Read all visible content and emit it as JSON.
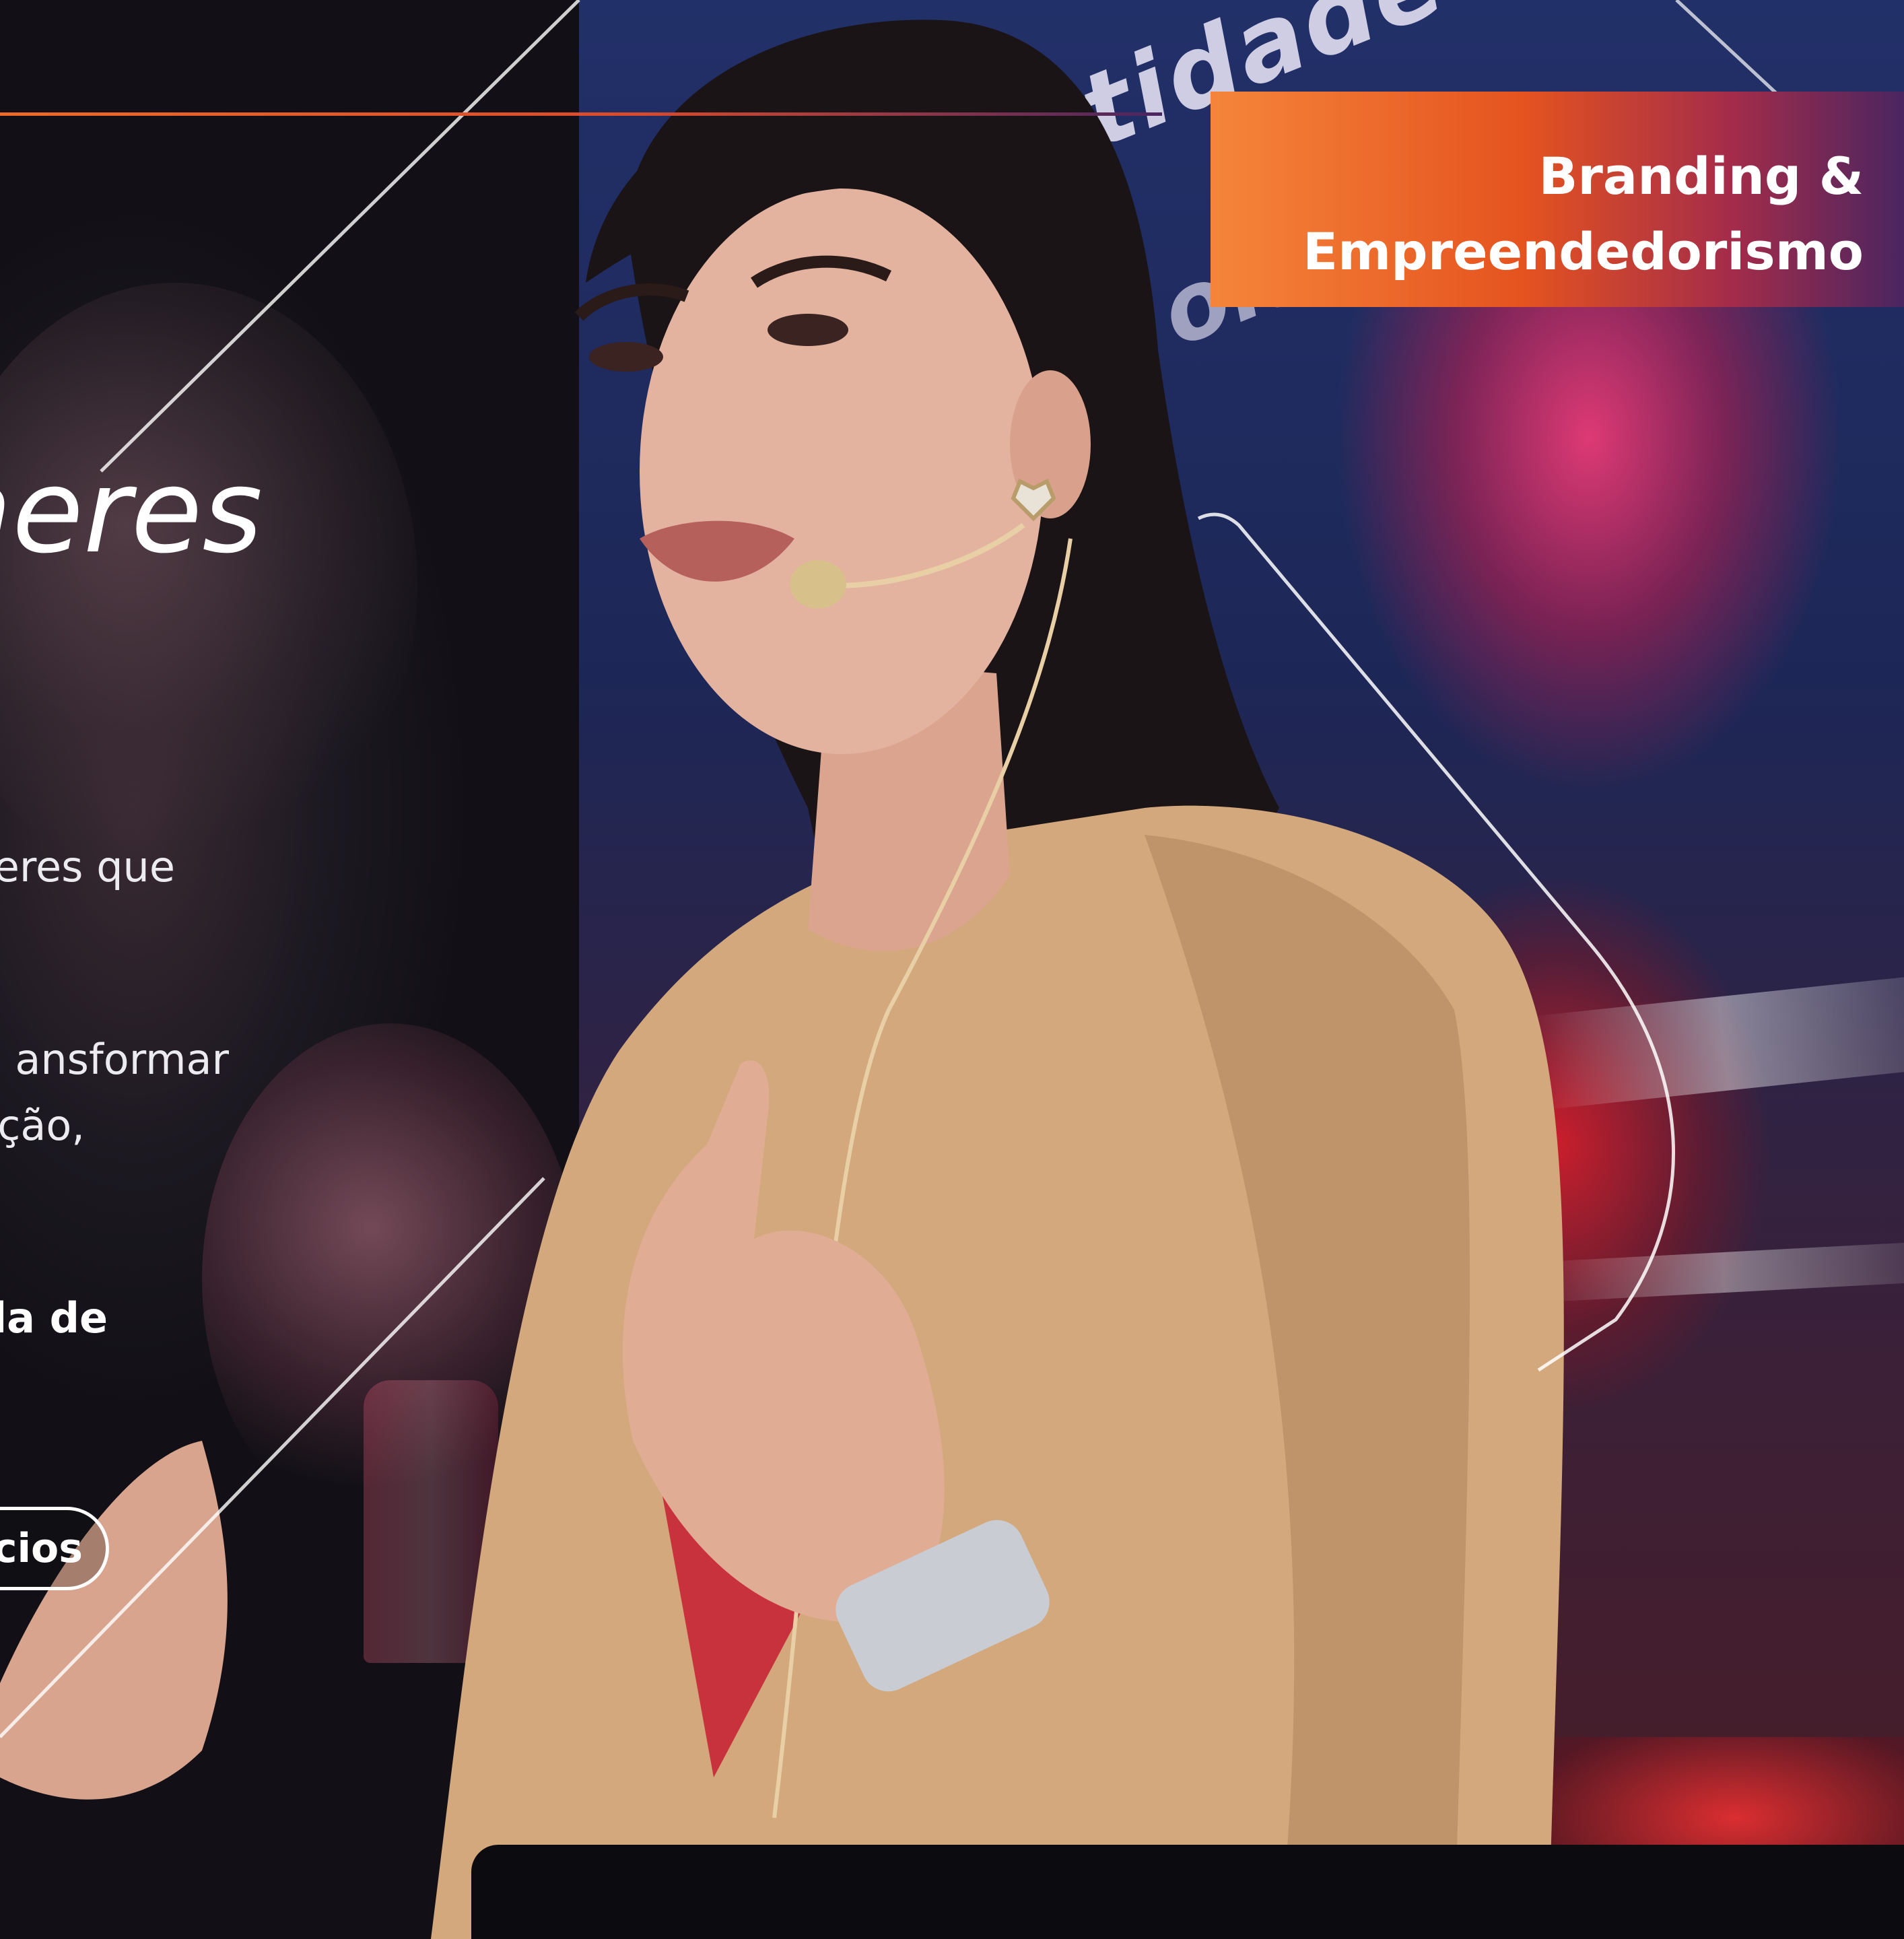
{
  "badge": {
    "line1": "Branding &",
    "line2": "Empreendedorismo"
  },
  "hero": {
    "headline_fragment": "heres",
    "body_fragments": [
      "eres que",
      "ansformar",
      "ção,"
    ],
    "emphasis_fragment": "da de",
    "cta_label_fragment": "cios"
  },
  "stage_backdrop": {
    "text_fragment": "ntidade d",
    "text_fragment2": "olas"
  },
  "colors": {
    "accent_orange": "#ef6a27",
    "accent_purple": "#4a2560",
    "badge_start": "#f5853a",
    "badge_end": "#4a2560"
  }
}
